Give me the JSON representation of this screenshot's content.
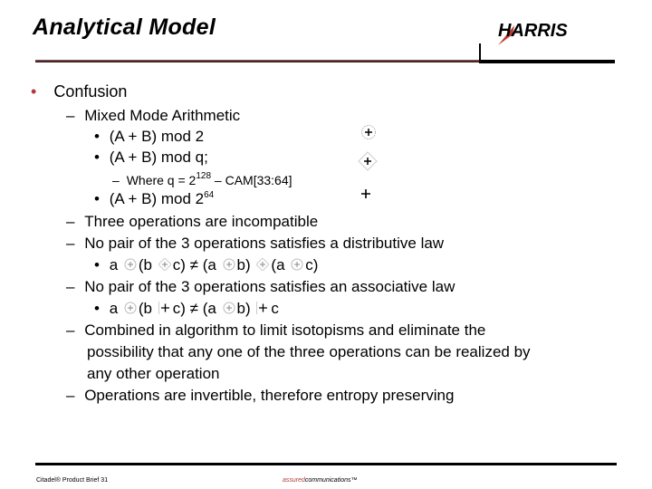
{
  "header": {
    "title": "Analytical Model",
    "logo_text": "HARRIS"
  },
  "content": {
    "l1": {
      "bullet": "•",
      "text": "Confusion"
    },
    "mixed": {
      "dash": "–",
      "text": "Mixed Mode Arithmetic"
    },
    "mod2": {
      "bullet": "•",
      "text": "(A + B) mod 2"
    },
    "modq": {
      "bullet": "•",
      "text": "(A + B) mod q;"
    },
    "where": {
      "dash": "–",
      "prefix": "Where q = 2",
      "exp": "128",
      "suffix": " – CAM[33:64]"
    },
    "mod264": {
      "bullet": "•",
      "prefix": "(A + B) mod 2",
      "exp": "64"
    },
    "incompat": {
      "dash": "–",
      "text": "Three operations are incompatible"
    },
    "distrib": {
      "dash": "–",
      "text": "No pair of the 3 operations satisfies a distributive law"
    },
    "distrib_eq": {
      "bullet": "•",
      "p1": "a",
      "p2": "(b",
      "p3": "c) ≠ (a",
      "p4": "b)",
      "p5": "(a",
      "p6": "c)"
    },
    "assoc": {
      "dash": "–",
      "text": "No pair of the 3 operations satisfies an associative law"
    },
    "assoc_eq": {
      "bullet": "•",
      "p1": "a",
      "p2": "(b",
      "p3": "c) ≠ (a",
      "p4": "b)",
      "p5": "c"
    },
    "combined1": {
      "dash": "–",
      "text": "Combined in algorithm to limit isotopisms and eliminate the"
    },
    "combined2": {
      "text": "possibility that any one of the three operations can be realized by"
    },
    "combined3": {
      "text": "any other operation"
    },
    "invert": {
      "dash": "–",
      "text": "Operations are invertible, therefore entropy preserving"
    }
  },
  "operator_icons": [
    "circle-plus-icon",
    "diamond-plus-icon",
    "boxed-plus-icon"
  ],
  "footer": {
    "left": "Citadel® Product Brief 31",
    "mid_accent": "assured",
    "mid_rest": "communications™"
  },
  "colors": {
    "accent": "#b03a3a"
  }
}
